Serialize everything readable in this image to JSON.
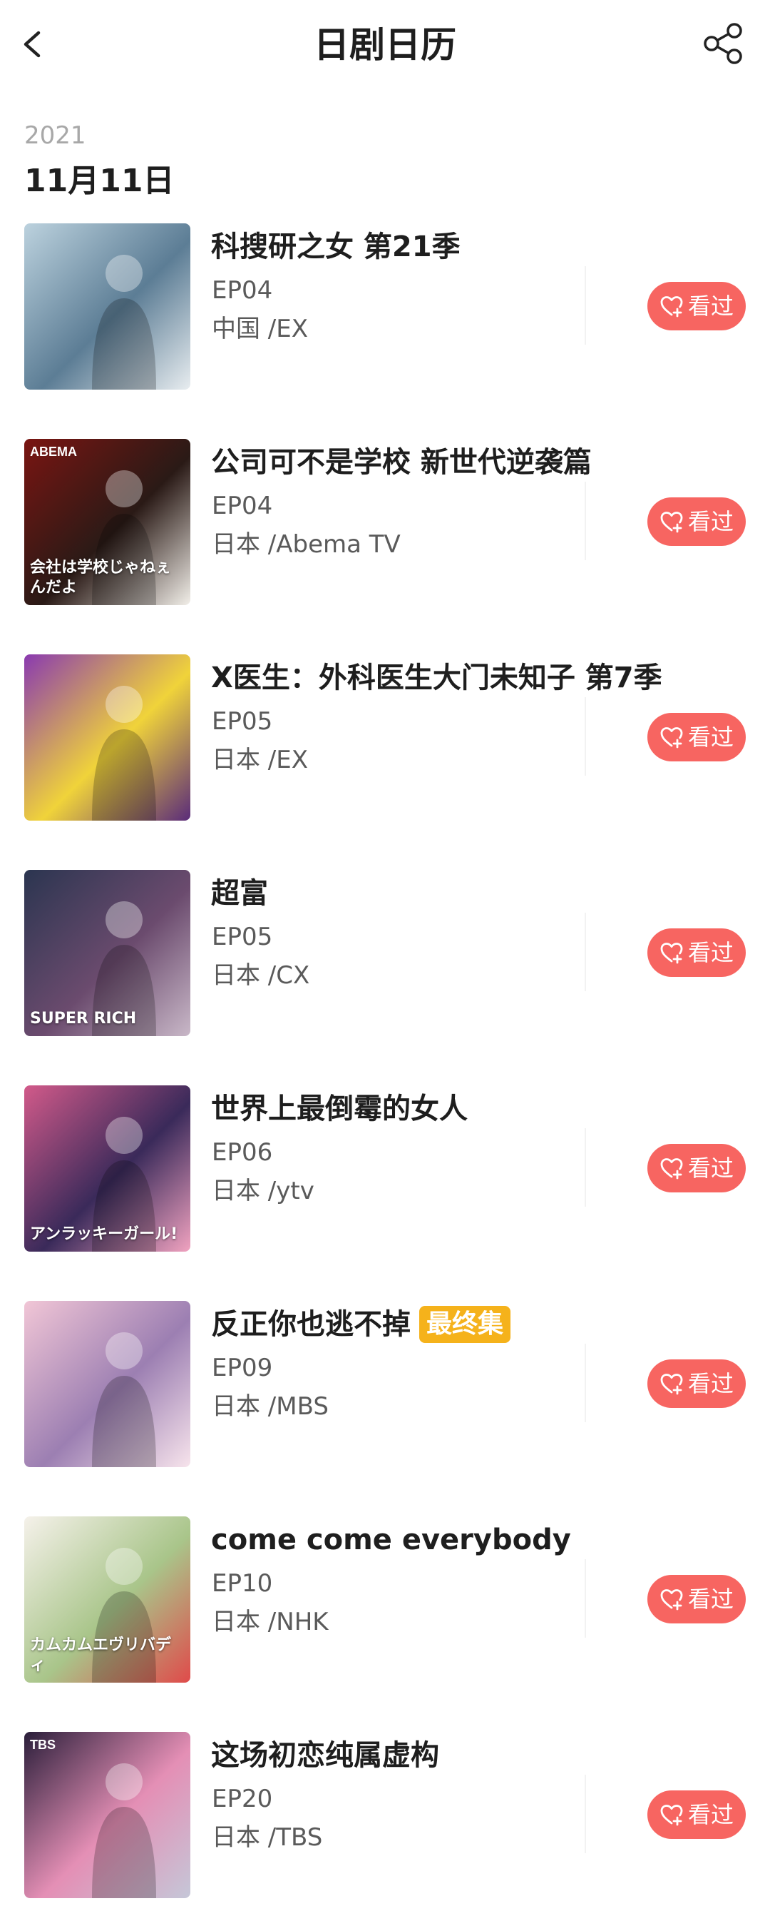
{
  "header": {
    "title": "日剧日历",
    "back_icon": "chevron-left-icon",
    "share_icon": "share-icon"
  },
  "date": {
    "year": "2021",
    "day": "11月11日"
  },
  "colors": {
    "accent": "#f76561",
    "badge": "#f5b21b"
  },
  "items": [
    {
      "title": "科搜研之女 第21季",
      "episode": "EP04",
      "origin": "中国 /EX",
      "badge": "",
      "button_label": "看过",
      "poster": {
        "caption": "",
        "brand": "",
        "colors": [
          "#bcd2de",
          "#5c7d95",
          "#e8edf0"
        ]
      }
    },
    {
      "title": "公司可不是学校 新世代逆袭篇",
      "episode": "EP04",
      "origin": "日本 /Abema TV",
      "badge": "",
      "button_label": "看过",
      "poster": {
        "caption": "会社は学校じゃねぇんだよ",
        "brand": "ABEMA",
        "colors": [
          "#7a1512",
          "#2a1a16",
          "#f2efe9"
        ]
      }
    },
    {
      "title": "X医生：外科医生大门未知子 第7季",
      "episode": "EP05",
      "origin": "日本 /EX",
      "badge": "",
      "button_label": "看过",
      "poster": {
        "caption": "",
        "brand": "",
        "colors": [
          "#8a3ab0",
          "#f0d33a",
          "#5a2b7a"
        ]
      }
    },
    {
      "title": "超富",
      "episode": "EP05",
      "origin": "日本 /CX",
      "badge": "",
      "button_label": "看过",
      "poster": {
        "caption": "SUPER RICH",
        "brand": "",
        "colors": [
          "#2b3550",
          "#6b4b6e",
          "#c9b8c8"
        ]
      }
    },
    {
      "title": "世界上最倒霉的女人",
      "episode": "EP06",
      "origin": "日本 /ytv",
      "badge": "",
      "button_label": "看过",
      "poster": {
        "caption": "アンラッキーガール!",
        "brand": "",
        "colors": [
          "#d25a8a",
          "#3a2a5a",
          "#f1a3c0"
        ]
      }
    },
    {
      "title": "反正你也逃不掉",
      "episode": "EP09",
      "origin": "日本 /MBS",
      "badge": "最终集",
      "button_label": "看过",
      "poster": {
        "caption": "",
        "brand": "",
        "colors": [
          "#f1c6d6",
          "#9c7fb2",
          "#f7e4ec"
        ]
      }
    },
    {
      "title": "come come everybody",
      "episode": "EP10",
      "origin": "日本 /NHK",
      "badge": "",
      "button_label": "看过",
      "poster": {
        "caption": "カムカムエヴリバディ",
        "brand": "",
        "colors": [
          "#f5f1ea",
          "#a9c58a",
          "#e04a4a"
        ]
      }
    },
    {
      "title": "这场初恋纯属虚构",
      "episode": "EP20",
      "origin": "日本 /TBS",
      "badge": "",
      "button_label": "看过",
      "poster": {
        "caption": "",
        "brand": "TBS",
        "colors": [
          "#2a1e3a",
          "#e48fb5",
          "#c5c7d8"
        ]
      }
    }
  ]
}
